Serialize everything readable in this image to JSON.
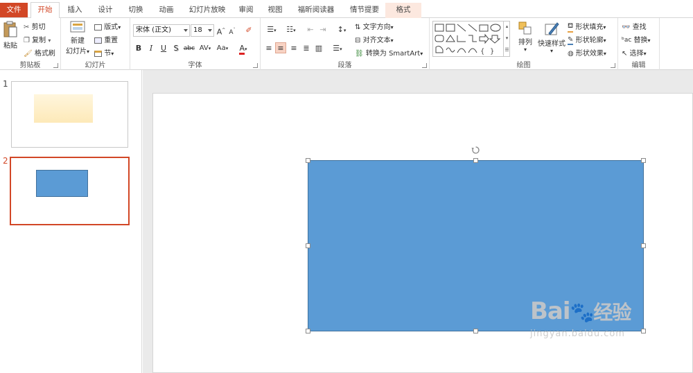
{
  "tabs": [
    "文件",
    "开始",
    "插入",
    "设计",
    "切换",
    "动画",
    "幻灯片放映",
    "审阅",
    "视图",
    "福昕阅读器",
    "情节提要",
    "格式"
  ],
  "clipboard": {
    "paste": "粘贴",
    "cut": "剪切",
    "copy": "复制",
    "format_painter": "格式刷",
    "label": "剪贴板"
  },
  "slides_group": {
    "new_slide": "新建",
    "new_slide2": "幻灯片",
    "layout": "版式",
    "reset": "重置",
    "section": "节",
    "label": "幻灯片"
  },
  "font": {
    "name": "宋体 (正文)",
    "size": "18",
    "label": "字体",
    "bold": "B",
    "italic": "I",
    "underline": "U",
    "shadow": "S",
    "strike": "abc",
    "spacing": "AV",
    "case": "Aa",
    "color": "A"
  },
  "paragraph": {
    "text_direction": "文字方向",
    "align_text": "对齐文本",
    "smartart": "转换为 SmartArt",
    "label": "段落"
  },
  "drawing": {
    "arrange": "排列",
    "quick_styles": "快速样式",
    "fill": "形状填充",
    "outline": "形状轮廓",
    "effects": "形状效果",
    "label": "绘图"
  },
  "editing": {
    "find": "查找",
    "replace": "替换",
    "select": "选择",
    "label": "编辑"
  },
  "thumbnails": [
    {
      "number": "1"
    },
    {
      "number": "2"
    }
  ],
  "colors": {
    "accent": "#d24726",
    "shape_fill": "#5b9bd5",
    "shape_border": "#41719c",
    "slide1_gradient": "#fde9b8"
  },
  "watermark": {
    "brand": "Bai",
    "brand2": "经验",
    "url": "jingyan.baidu.com"
  }
}
